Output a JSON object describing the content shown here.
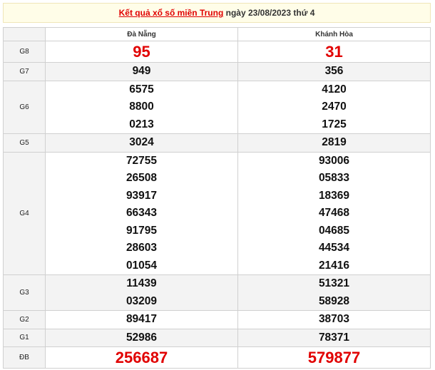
{
  "title": {
    "link_text": "Kết quả xổ số miền Trung",
    "rest": " ngày 23/08/2023 thứ 4"
  },
  "columns": [
    "Đà Nẵng",
    "Khánh Hòa"
  ],
  "prizes": [
    {
      "label": "G8",
      "values": [
        [
          "95"
        ],
        [
          "31"
        ]
      ]
    },
    {
      "label": "G7",
      "values": [
        [
          "949"
        ],
        [
          "356"
        ]
      ]
    },
    {
      "label": "G6",
      "values": [
        [
          "6575",
          "8800",
          "0213"
        ],
        [
          "4120",
          "2470",
          "1725"
        ]
      ]
    },
    {
      "label": "G5",
      "values": [
        [
          "3024"
        ],
        [
          "2819"
        ]
      ]
    },
    {
      "label": "G4",
      "values": [
        [
          "72755",
          "26508",
          "93917",
          "66343",
          "91795",
          "28603",
          "01054"
        ],
        [
          "93006",
          "05833",
          "18369",
          "47468",
          "04685",
          "44534",
          "21416"
        ]
      ]
    },
    {
      "label": "G3",
      "values": [
        [
          "11439",
          "03209"
        ],
        [
          "51321",
          "58928"
        ]
      ]
    },
    {
      "label": "G2",
      "values": [
        [
          "89417"
        ],
        [
          "38703"
        ]
      ]
    },
    {
      "label": "G1",
      "values": [
        [
          "52986"
        ],
        [
          "78371"
        ]
      ]
    },
    {
      "label": "ĐB",
      "values": [
        [
          "256687"
        ],
        [
          "579877"
        ]
      ]
    }
  ],
  "colors": {
    "accent_red": "#e10000",
    "title_bg": "#fffde8"
  }
}
